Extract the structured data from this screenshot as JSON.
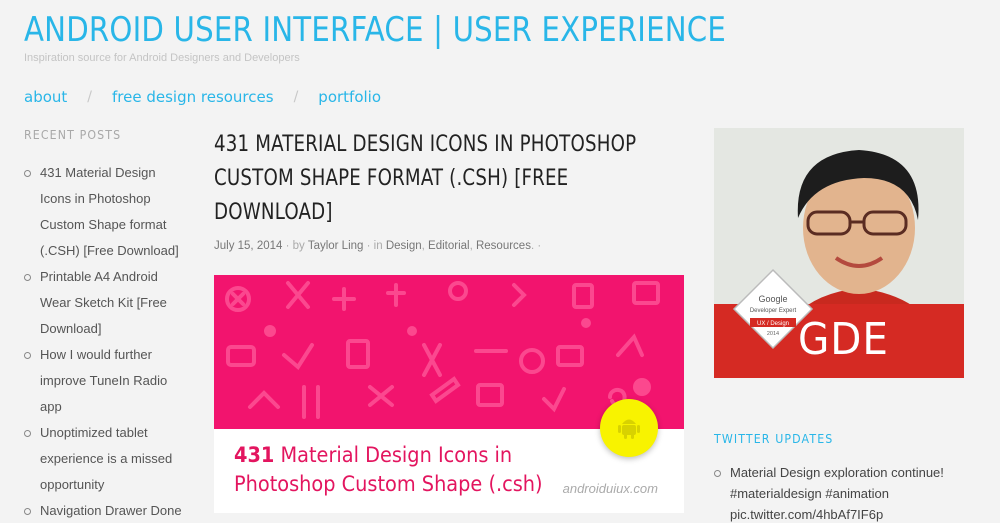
{
  "site": {
    "title": "ANDROID USER INTERFACE | USER EXPERIENCE",
    "tagline": "Inspiration source for Android Designers and Developers"
  },
  "nav": {
    "items": [
      {
        "label": "about"
      },
      {
        "label": "free design resources"
      },
      {
        "label": "portfolio"
      }
    ],
    "separator": "/"
  },
  "recent_posts": {
    "title": "RECENT POSTS",
    "items": [
      {
        "label": "431 Material Design Icons in Photoshop Custom Shape format (.CSH) [Free Download]"
      },
      {
        "label": "Printable A4 Android Wear Sketch Kit [Free Download]"
      },
      {
        "label": "How I would further improve TuneIn Radio app"
      },
      {
        "label": "Unoptimized tablet experience is a missed opportunity"
      },
      {
        "label": "Navigation Drawer Done"
      }
    ]
  },
  "post": {
    "title": "431 MATERIAL DESIGN ICONS IN PHOTOSHOP CUSTOM SHAPE FORMAT (.CSH) [FREE DOWNLOAD]",
    "date": "July 15, 2014",
    "by_label": "by",
    "author": "Taylor Ling",
    "in_label": "in",
    "categories": [
      "Design",
      "Editorial",
      "Resources"
    ],
    "banner": {
      "headline_number": "431",
      "headline_line1_rest": " Material Design Icons in",
      "headline_line2": "Photoshop Custom Shape (.csh)",
      "site": "androiduiux.com",
      "bg_color": "#f2146e",
      "fab_color": "#f8f300"
    }
  },
  "profile": {
    "badge_line1": "Google",
    "badge_line2": "Developer Expert",
    "badge_line3": "UX / Design",
    "badge_year": "2014",
    "gde_label": "GDE"
  },
  "twitter": {
    "title": "TWITTER UPDATES",
    "tweet_line1": "Material Design exploration continue!",
    "tweet_line2": "#materialdesign #animation",
    "tweet_line3": "pic.twitter.com/4hbAf7IF6p"
  },
  "colors": {
    "accent": "#29b6e8",
    "gde_red": "#d52a23"
  }
}
